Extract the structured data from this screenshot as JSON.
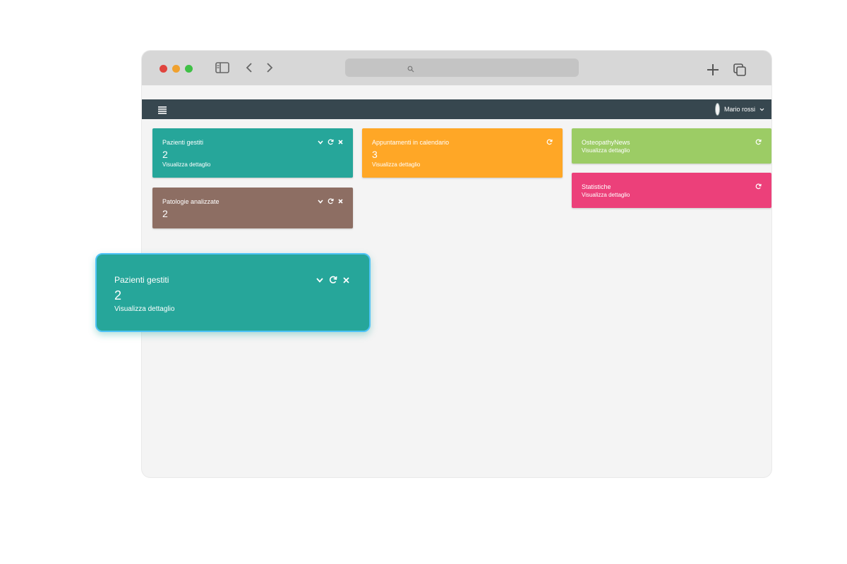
{
  "colors": {
    "teal": "#26a69a",
    "orange": "#ffa726",
    "green": "#9ccc65",
    "pink": "#ec407a",
    "brown": "#8d6e63",
    "appbar": "#37474f",
    "traffic_red": "#e0443e",
    "traffic_yellow": "#f0a12e",
    "traffic_green": "#3fc046"
  },
  "browser": {
    "icons": [
      "sidebar-toggle-icon",
      "back-chevron-icon",
      "forward-chevron-icon",
      "search-icon",
      "plus-icon",
      "tabs-overview-icon"
    ]
  },
  "appbar": {
    "menu_icon": "hamburger-icon",
    "user_name": "Mario rossi"
  },
  "cards": {
    "pazienti": {
      "title": "Pazienti gestiti",
      "value": "2",
      "link": "Visualizza dettaglio"
    },
    "appuntamenti": {
      "title": "Appuntamenti in calendario",
      "value": "3",
      "link": "Visualizza dettaglio"
    },
    "news": {
      "title": "OsteopathyNews",
      "link": "Visualizza dettaglio"
    },
    "patologie": {
      "title": "Patologie analizzate",
      "value": "2"
    },
    "statistiche": {
      "title": "Statistiche",
      "link": "Visualizza dettaglio"
    }
  },
  "floating_card": {
    "title": "Pazienti gestiti",
    "value": "2",
    "link": "Visualizza dettaglio"
  }
}
